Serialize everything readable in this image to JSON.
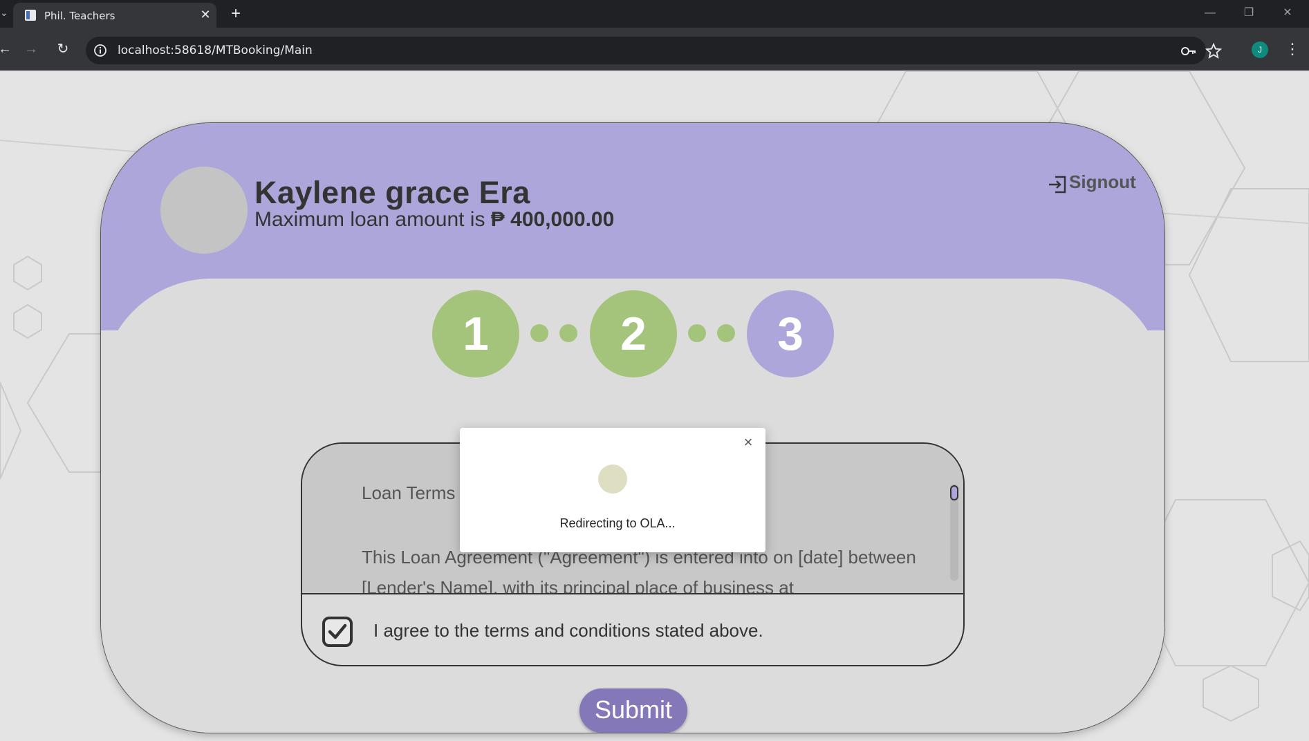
{
  "browser": {
    "tab_title": "Phil. Teachers",
    "tab_close": "✕",
    "new_tab": "+",
    "url": "localhost:58618/MTBooking/Main",
    "profile_initial": "J"
  },
  "header": {
    "user_name": "Kaylene grace Era",
    "loan_prefix": "Maximum loan amount is ",
    "loan_amount": "₱ 400,000.00",
    "signout_label": "Signout"
  },
  "steps": [
    {
      "number": "1",
      "state": "done"
    },
    {
      "number": "2",
      "state": "done"
    },
    {
      "number": "3",
      "state": "active"
    }
  ],
  "terms": {
    "title": "Loan Terms and Agreement",
    "paragraph": "This Loan Agreement (\"Agreement\") is entered into on [date] between [Lender's Name], with its principal place of business at",
    "agree_label": "I agree to the terms and conditions stated above.",
    "agree_checked": true
  },
  "submit_label": "Submit",
  "modal": {
    "close": "×",
    "message": "Redirecting to OLA..."
  },
  "colors": {
    "header_purple": "#aca6da",
    "step_green": "#a3c47a",
    "submit_purple": "#8478b8"
  }
}
